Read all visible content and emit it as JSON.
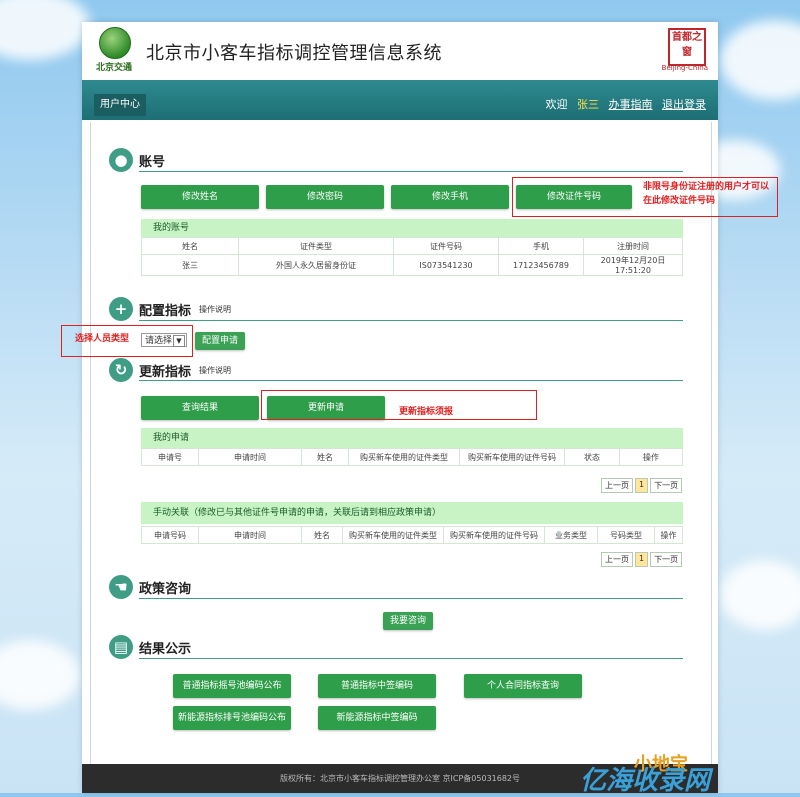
{
  "header": {
    "logo_text": "北京交通",
    "title": "北京市小客车指标调控管理信息系统",
    "seal_text": "首都之窗",
    "seal_sub": "Beijing-China"
  },
  "nav": {
    "tab": "用户中心",
    "welcome": "欢迎",
    "user": "张三",
    "guide": "办事指南",
    "logout": "退出登录"
  },
  "account": {
    "title": "账号",
    "buttons": [
      "修改姓名",
      "修改密码",
      "修改手机",
      "修改证件号码"
    ],
    "annotation": "非限号身份证注册的用户才可以在此修改证件号码",
    "table_title": "我的账号",
    "headers": [
      "姓名",
      "证件类型",
      "证件号码",
      "手机",
      "注册时间"
    ],
    "row": [
      "张三",
      "外国人永久居留身份证",
      "IS073541230",
      "17123456789",
      "2019年12月20日17:51:20"
    ]
  },
  "config": {
    "title": "配置指标",
    "sub": "操作说明",
    "annotation": "选择人员类型",
    "select_value": "请选择",
    "button": "配置申请"
  },
  "update": {
    "title": "更新指标",
    "sub": "操作说明",
    "buttons": [
      "查询结果",
      "更新申请"
    ],
    "annotation": "更新指标须报",
    "my_apps_title": "我的申请",
    "my_apps_headers": [
      "申请号",
      "申请时间",
      "姓名",
      "购买新车使用的证件类型",
      "购买新车使用的证件号码",
      "状态",
      "操作"
    ],
    "pager1": [
      "上一页",
      "1",
      "下一页"
    ],
    "manual_title": "手动关联（修改已与其他证件号申请的申请，关联后请到相应政策申请）",
    "manual_headers": [
      "申请号码",
      "申请时间",
      "姓名",
      "购买新车使用的证件类型",
      "购买新车使用的证件号码",
      "业务类型",
      "号码类型",
      "操作"
    ],
    "pager2": [
      "上一页",
      "1",
      "下一页"
    ]
  },
  "policy": {
    "title": "政策咨询",
    "button": "我要咨询"
  },
  "results": {
    "title": "结果公示",
    "buttons": [
      "普通指标摇号池编码公布",
      "普通指标中签编码",
      "个人合同指标查询",
      "新能源指标排号池编码公布",
      "新能源指标中签编码"
    ]
  },
  "footer": {
    "text": "版权所有：北京市小客车指标调控管理办公室  京ICP备05031682号"
  },
  "watermark": {
    "text1": "亿海收录网",
    "text2": "小地宝"
  },
  "colors": {
    "green_button": "#2f9e4a",
    "nav_teal": "#1d6f74",
    "annotation_red": "#e02020"
  }
}
